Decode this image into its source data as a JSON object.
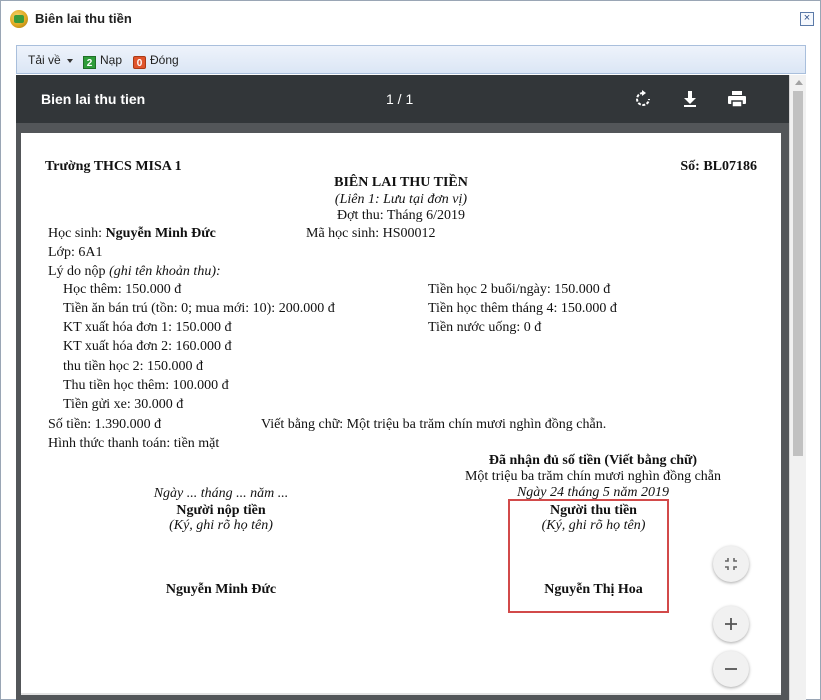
{
  "window": {
    "title": "Biên lai thu tiền",
    "close_symbol": "×"
  },
  "toolbar": {
    "download_label": "Tải về",
    "load_label": "Nạp",
    "close_label": "Đóng"
  },
  "viewer": {
    "doc_title": "Bien lai thu tien",
    "page_indicator": "1 / 1"
  },
  "receipt": {
    "school": "Trường THCS MISA 1",
    "number": "Số: BL07186",
    "heading": "BIÊN LAI THU TIỀN",
    "copy_note": "(Liên 1: Lưu tại đơn vị)",
    "period": "Đợt thu: Tháng 6/2019",
    "student_label": "Học sinh: ",
    "student_name": "Nguyễn Minh Đức",
    "student_code": "Mã học sinh: HS00012",
    "class_line": "Lớp:  6A1",
    "reason_label": "Lý do nộp ",
    "reason_note": "(ghi tên khoản thu):",
    "fees_left": [
      "Học thêm: 150.000 đ",
      "Tiền ăn bán trú (tồn: 0; mua mới: 10): 200.000 đ",
      "KT xuất hóa đơn 1: 150.000 đ",
      "KT xuất hóa đơn 2: 160.000 đ",
      "thu tiền học 2: 150.000 đ",
      "Thu tiền học thêm: 100.000 đ",
      "Tiền gửi xe: 30.000 đ"
    ],
    "fees_right": [
      "Tiền học 2 buổi/ngày: 150.000 đ",
      "Tiền học thêm tháng 4: 150.000 đ",
      "Tiền nước uống: 0 đ"
    ],
    "amount": "Số tiền: 1.390.000 đ",
    "amount_words": "Viết bằng chữ: Một triệu ba trăm chín mươi nghìn đồng chẵn.",
    "payment_method": "Hình thức thanh toán:  tiền mặt",
    "received_heading": "Đã nhận đủ số tiền (Viết bằng chữ)",
    "received_words": "Một triệu ba trăm chín mươi nghìn đồng chẵn",
    "date_left": "Ngày ... tháng ... năm ...",
    "date_right": "Ngày 24 tháng 5 năm 2019",
    "payer_title": "Người nộp tiền",
    "payer_note": "(Ký, ghi rõ họ tên)",
    "payer_name": "Nguyễn Minh Đức",
    "collector_title": "Người thu tiền",
    "collector_note": "(Ký, ghi rõ họ tên)",
    "collector_name": "Nguyễn Thị Hoa"
  },
  "icons": {
    "rotate": "rotate-icon",
    "download": "download-icon",
    "print": "print-icon",
    "fit": "fit-page-icon",
    "zoom_in": "zoom-in-icon",
    "zoom_out": "zoom-out-icon"
  },
  "colors": {
    "viewer_bg": "#535659",
    "viewer_bar": "#323639",
    "highlight": "#d24a4a"
  }
}
